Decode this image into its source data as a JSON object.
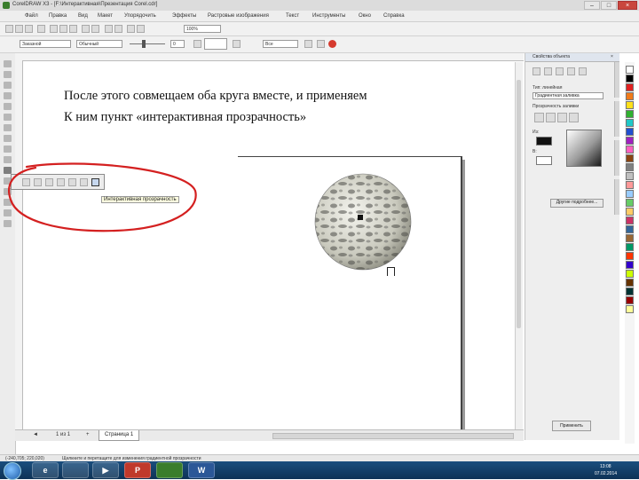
{
  "window": {
    "title": "CorelDRAW X3 - [F:\\Интерактивная\\Презентация Corel.cdr]"
  },
  "menu": [
    "Файл",
    "Правка",
    "Вид",
    "Макет",
    "Упорядочить",
    "Эффекты",
    "Растровые изображения",
    "Текст",
    "Инструменты",
    "Окно",
    "Справка"
  ],
  "toolbar": {
    "zoom": "100%",
    "paper_size": "Заказной",
    "units": "Обычный",
    "line_width": "0",
    "fill": "Все"
  },
  "caption": {
    "line1": "После этого совмещаем оба круга вместе, и применяем",
    "line2": "К ним пункт «интерактивная прозрачность»"
  },
  "flyout": {
    "tooltip": "Интерактивная прозрачность"
  },
  "pages": {
    "counter": "1 из 1",
    "tab": "Страница 1"
  },
  "docker": {
    "header": "Свойства объекта",
    "section": "Прозрачность заливки",
    "type_label": "Тип: линейная",
    "type_value": "Градиентная заливка",
    "from_label": "Из:",
    "to_label": "В:",
    "apply": "Другие подробнее...",
    "apply_bottom": "Применить"
  },
  "status": {
    "coords": "(-240,705; 220,020)",
    "message": "Щелкните и перетащите для изменения градиентной прозрачности"
  },
  "clock": {
    "time": "13:08",
    "date": "07.02.2014"
  },
  "palette": [
    "#ffffff",
    "#000000",
    "#e02020",
    "#f07a1a",
    "#ffe01a",
    "#30b030",
    "#20c8c8",
    "#2050d0",
    "#a020c0",
    "#ff60c0",
    "#8b4513",
    "#808080",
    "#c0c0c0",
    "#ff9999",
    "#99ccff",
    "#66cc66",
    "#ffcc66",
    "#cc3366",
    "#336699",
    "#996633",
    "#009966",
    "#ff3300",
    "#3300cc",
    "#ccff00",
    "#663300",
    "#003333",
    "#990000",
    "#ffff99"
  ],
  "colors": {
    "annotation": "#d42020"
  }
}
